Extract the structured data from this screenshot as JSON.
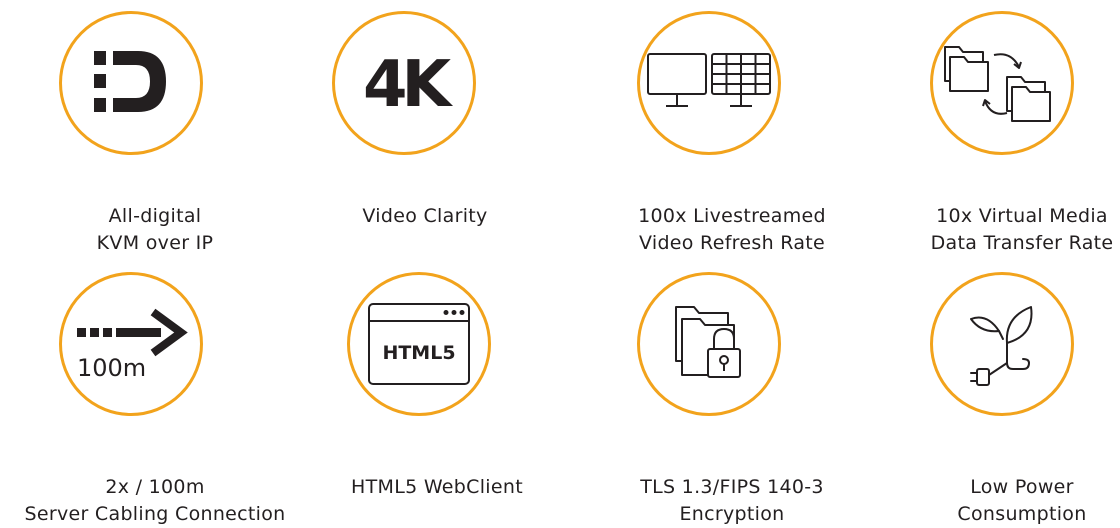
{
  "accent_color": "#f2a31c",
  "features": [
    {
      "icon": "digital-d-icon",
      "caption": [
        "All-digital",
        "KVM over IP"
      ]
    },
    {
      "icon": "4k-icon",
      "icon_text": "4K",
      "caption": [
        "Video Clarity"
      ]
    },
    {
      "icon": "dual-monitor-icon",
      "caption": [
        "100x Livestreamed",
        "Video Refresh Rate"
      ]
    },
    {
      "icon": "folder-transfer-icon",
      "caption": [
        "10x Virtual Media",
        "Data Transfer Rate"
      ]
    },
    {
      "icon": "cable-distance-arrow-icon",
      "icon_text": "100m",
      "caption": [
        "2x / 100m",
        "Server Cabling Connection"
      ]
    },
    {
      "icon": "html5-browser-window-icon",
      "icon_text": "HTML5",
      "caption": [
        "HTML5 WebClient"
      ]
    },
    {
      "icon": "encrypted-folder-lock-icon",
      "caption": [
        "TLS 1.3/FIPS 140-3",
        "Encryption"
      ]
    },
    {
      "icon": "plant-plug-icon",
      "caption": [
        "Low Power",
        "Consumption"
      ]
    }
  ]
}
